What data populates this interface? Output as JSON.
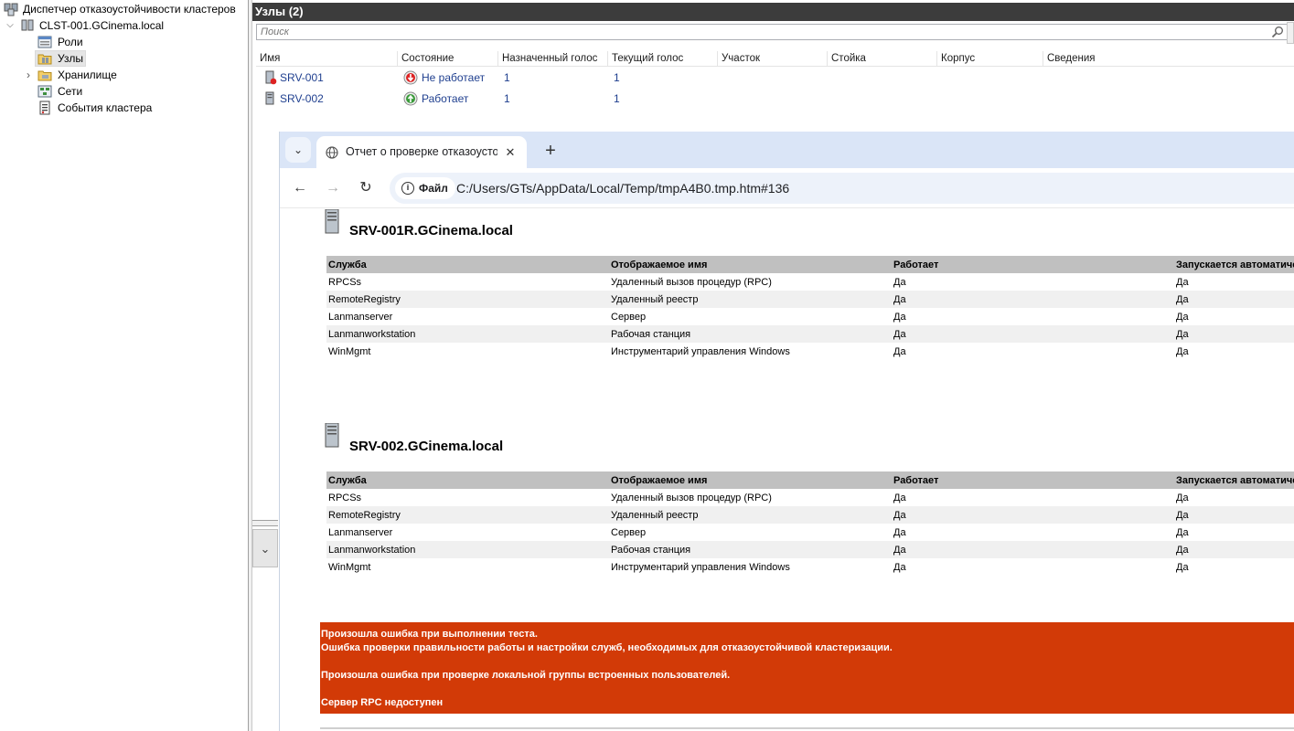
{
  "tree": {
    "root": "Диспетчер отказоустойчивости кластеров",
    "cluster": "CLST-001.GCinema.local",
    "items": [
      {
        "label": "Роли"
      },
      {
        "label": "Узлы"
      },
      {
        "label": "Хранилище"
      },
      {
        "label": "Сети"
      },
      {
        "label": "События кластера"
      }
    ],
    "selected": "Узлы"
  },
  "panel": {
    "title": "Узлы (2)",
    "search_placeholder": "Поиск",
    "columns": [
      "Имя",
      "Состояние",
      "Назначенный голос",
      "Текущий голос",
      "Участок",
      "Стойка",
      "Корпус",
      "Сведения"
    ],
    "nodes": [
      {
        "name": "SRV-001",
        "status": "Не работает",
        "status_kind": "down",
        "assigned_vote": "1",
        "current_vote": "1"
      },
      {
        "name": "SRV-002",
        "status": "Работает",
        "status_kind": "up",
        "assigned_vote": "1",
        "current_vote": "1"
      }
    ]
  },
  "browser": {
    "tab_title": "Отчет о проверке отказоустойчивости",
    "address_chip": "Файл",
    "url": "C:/Users/GTs/AppData/Local/Temp/tmpA4B0.tmp.htm#136"
  },
  "report": {
    "table_headers": [
      "Служба",
      "Отображаемое имя",
      "Работает",
      "Запускается автоматически"
    ],
    "servers": [
      {
        "name": "SRV-001R.GCinema.local",
        "rows": [
          [
            "RPCSs",
            "Удаленный вызов процедур (RPC)",
            "Да",
            "Да"
          ],
          [
            "RemoteRegistry",
            "Удаленный реестр",
            "Да",
            "Да"
          ],
          [
            "Lanmanserver",
            "Сервер",
            "Да",
            "Да"
          ],
          [
            "Lanmanworkstation",
            "Рабочая станция",
            "Да",
            "Да"
          ],
          [
            "WinMgmt",
            "Инструментарий управления Windows",
            "Да",
            "Да"
          ]
        ]
      },
      {
        "name": "SRV-002.GCinema.local",
        "rows": [
          [
            "RPCSs",
            "Удаленный вызов процедур (RPC)",
            "Да",
            "Да"
          ],
          [
            "RemoteRegistry",
            "Удаленный реестр",
            "Да",
            "Да"
          ],
          [
            "Lanmanserver",
            "Сервер",
            "Да",
            "Да"
          ],
          [
            "Lanmanworkstation",
            "Рабочая станция",
            "Да",
            "Да"
          ],
          [
            "WinMgmt",
            "Инструментарий управления Windows",
            "Да",
            "Да"
          ]
        ]
      }
    ],
    "error_lines": [
      "Произошла ошибка при выполнении теста.",
      "Ошибка проверки правильности работы и настройки служб, необходимых для отказоустойчивой кластеризации.",
      "",
      "Произошла ошибка при проверке локальной группы встроенных пользователей.",
      "",
      "Сервер RPC недоступен"
    ],
    "error_color": "#d23a07"
  },
  "colors": {
    "header_bg": "#3c3c3c",
    "tabstrip_bg": "#dae5f7",
    "link": "#1f3f8f"
  }
}
